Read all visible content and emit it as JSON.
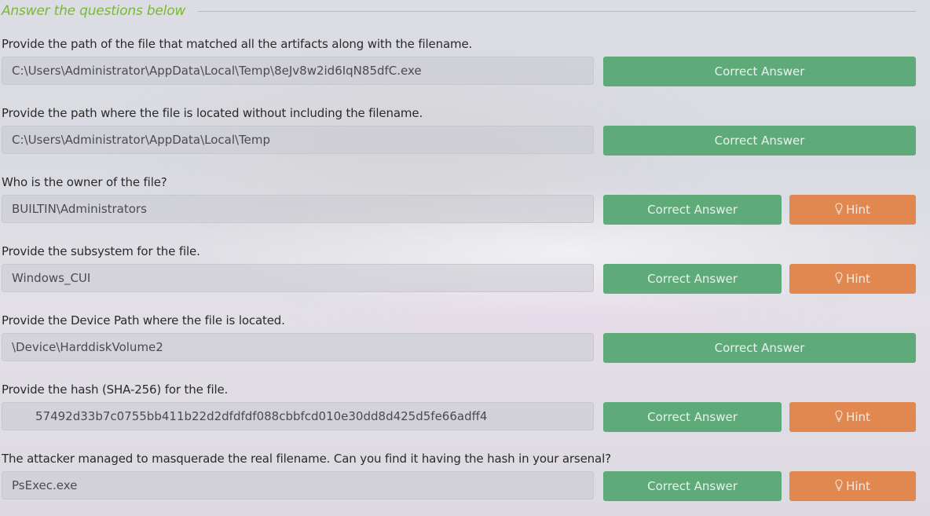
{
  "header": {
    "title": "Answer the questions below"
  },
  "questions": [
    {
      "text": "Provide the path of the file that matched all the artifacts along with the filename.",
      "answer": "C:\\Users\\Administrator\\AppData\\Local\\Temp\\8eJv8w2id6IqN85dfC.exe",
      "button_label": "Correct Answer"
    },
    {
      "text": "Provide the path where the file is located without including the filename.",
      "answer": "C:\\Users\\Administrator\\AppData\\Local\\Temp",
      "button_label": "Correct Answer"
    },
    {
      "text": "Who is the owner of the file?",
      "answer": "BUILTIN\\Administrators",
      "button_label": "Correct Answer",
      "hint_label": "Hint"
    },
    {
      "text": "Provide the subsystem for the file.",
      "answer": "Windows_CUI",
      "button_label": "Correct Answer",
      "hint_label": "Hint"
    },
    {
      "text": "Provide the Device Path where the file is located.",
      "answer": "\\Device\\HarddiskVolume2",
      "button_label": "Correct Answer"
    },
    {
      "text": "Provide the hash (SHA-256) for the file.",
      "answer": "57492d33b7c0755bb411b22d2dfdfdf088cbbfcd010e30dd8d425d5fe66adff4",
      "button_label": "Correct Answer",
      "hint_label": "Hint"
    },
    {
      "text": "The attacker managed to masquerade the real filename. Can you find it having the hash in your arsenal?",
      "answer": "PsExec.exe",
      "button_label": "Correct Answer",
      "hint_label": "Hint"
    }
  ],
  "colors": {
    "title_green": "#7ab833",
    "correct_green": "#5eaa78",
    "hint_orange": "#e08850"
  },
  "icons": {
    "hint": "lightbulb-icon"
  }
}
